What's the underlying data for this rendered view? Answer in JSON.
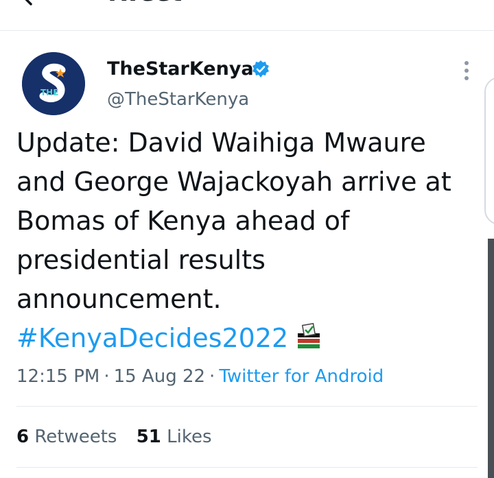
{
  "header": {
    "title": "Tweet"
  },
  "tweet": {
    "author": {
      "display_name": "TheStarKenya",
      "handle": "@TheStarKenya",
      "verified": true,
      "avatar_label": "THE"
    },
    "text_lines": [
      "Update: David Waihiga Mwaure",
      "and George Wajackoyah arrive at",
      "Bomas of Kenya ahead of",
      "presidential results",
      "announcement."
    ],
    "hashtag": "#KenyaDecides2022",
    "time": "12:15 PM",
    "date": "15 Aug 22",
    "separator": "·",
    "source": "Twitter for Android",
    "retweets_count": "6",
    "retweets_label": "Retweets",
    "likes_count": "51",
    "likes_label": "Likes"
  },
  "colors": {
    "link": "#1d9bf0",
    "text": "#0f1419",
    "secondary": "#536471",
    "avatar_bg": "#16306a"
  }
}
